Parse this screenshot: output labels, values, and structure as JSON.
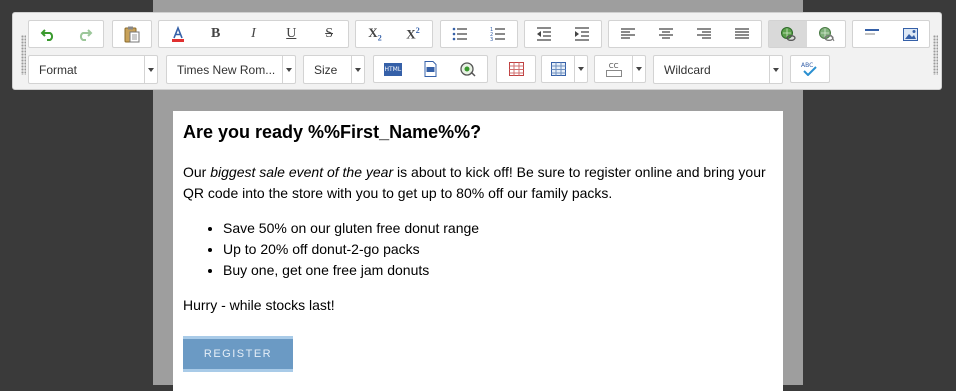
{
  "toolbar": {
    "row1": {
      "history": [
        "undo-icon",
        "redo-icon"
      ],
      "clipboard": [
        "paste-icon"
      ],
      "text_format": [
        "font-color-icon",
        "bold-icon",
        "italic-icon",
        "underline-icon",
        "strikethrough-icon"
      ],
      "script": [
        "subscript-icon",
        "superscript-icon"
      ],
      "lists": [
        "bulleted-list-icon",
        "numbered-list-icon"
      ],
      "indent": [
        "outdent-icon",
        "indent-icon"
      ],
      "align": [
        "align-left-icon",
        "align-center-icon",
        "align-right-icon",
        "justify-icon"
      ],
      "links": [
        "insert-link-icon",
        "remove-link-icon"
      ],
      "insert": [
        "horizontal-rule-icon",
        "insert-image-icon"
      ]
    },
    "row2": {
      "format_select": "Format",
      "font_select": "Times New Rom...",
      "size_select": "Size",
      "wildcard_select": "Wildcard",
      "html_label": "HTML",
      "cc_label": "CC",
      "abc_label": "ABC"
    }
  },
  "content": {
    "heading": "Are you ready %%First_Name%%?",
    "intro_pre": "Our ",
    "intro_em": "biggest sale event of the year",
    "intro_post": " is about to kick off! Be sure to register online and bring your QR code into the store with you to get up to 80% off our family packs.",
    "bullets": [
      "Save 50% on our gluten free donut range",
      "Up to 20% off donut-2-go packs",
      "Buy one, get one free jam donuts"
    ],
    "closing": "Hurry - while stocks last!",
    "register_label": "REGISTER"
  },
  "colors": {
    "page_bg": "#3a3a3a",
    "canvas_gray": "#9e9e9e",
    "toolbar_bg": "#f2f2f2",
    "button_blue": "#6b9ac4"
  }
}
